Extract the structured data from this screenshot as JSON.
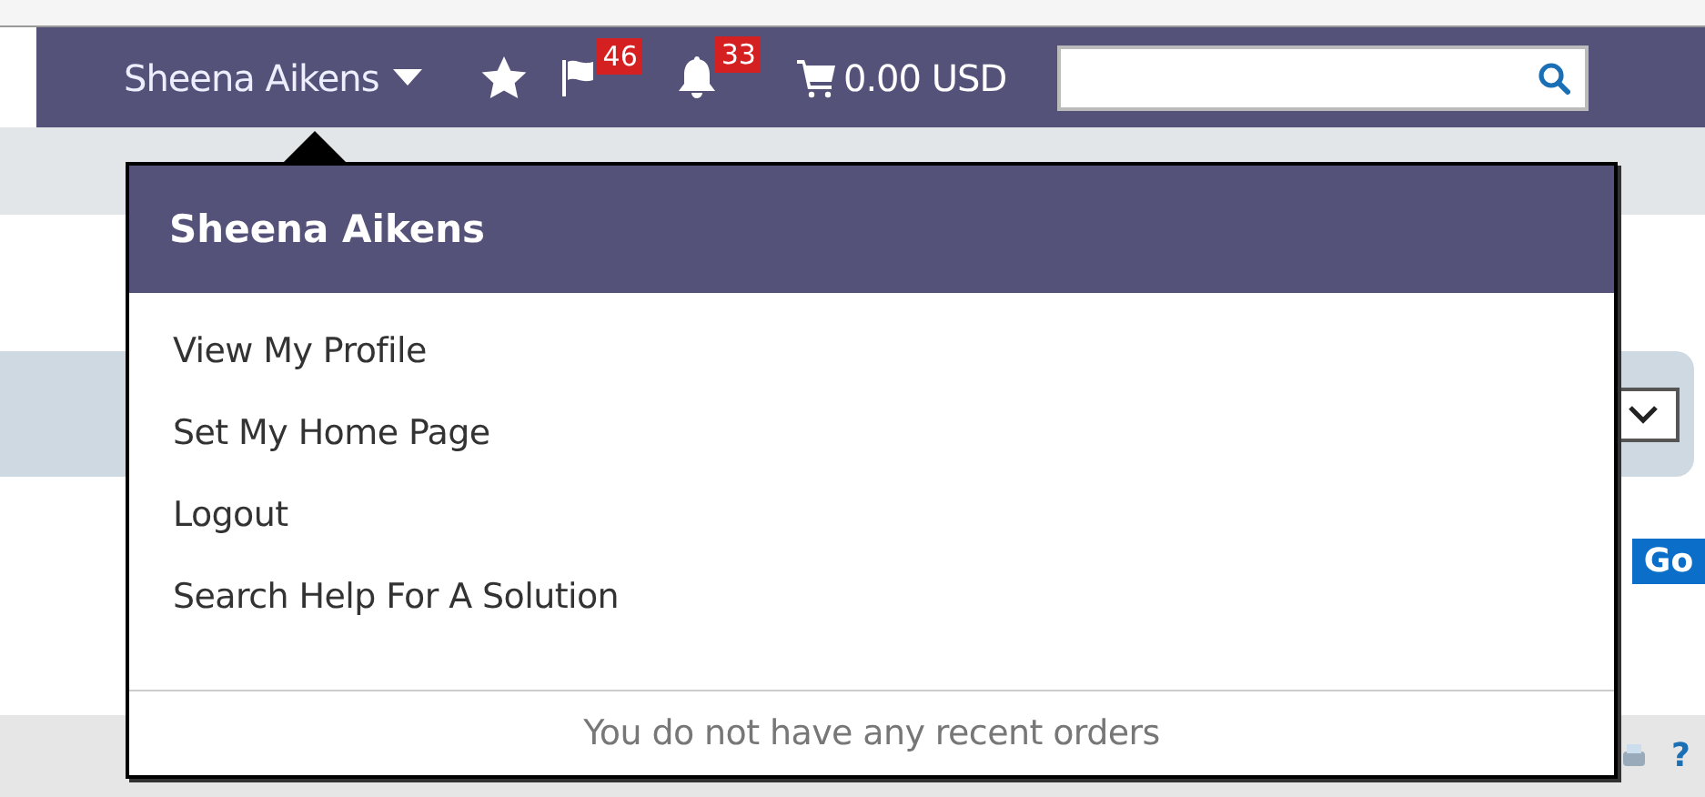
{
  "navbar": {
    "user_name": "Sheena Aikens",
    "flag_count": "46",
    "bell_count": "33",
    "cart_total": "0.00 USD"
  },
  "user_menu": {
    "title": "Sheena Aikens",
    "items": [
      "View My Profile",
      "Set My Home Page",
      "Logout",
      "Search Help For A Solution"
    ],
    "recent_orders": "You do not have any recent orders"
  },
  "page": {
    "go_button": "Go",
    "help_link": "?"
  }
}
